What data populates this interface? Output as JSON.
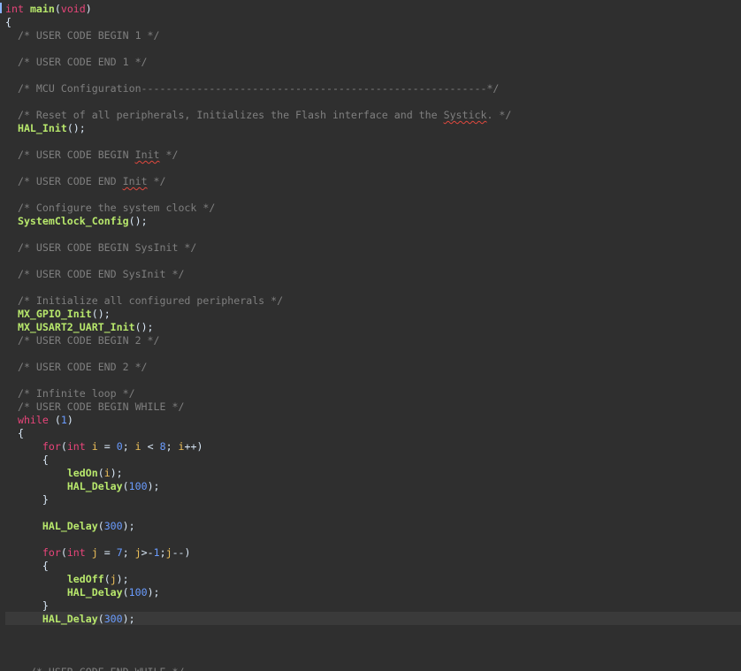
{
  "editor": {
    "colors": {
      "background": "#2f2f2f",
      "keyword": "#e8457a",
      "function": "#b8e86c",
      "comment": "#7f7f7f",
      "number": "#6a9cff",
      "variable": "#f0c25a",
      "text": "#d9e8f7"
    },
    "lines": [
      {
        "tokens": [
          {
            "t": "int",
            "c": "kw"
          },
          {
            "t": " ",
            "c": "pl"
          },
          {
            "t": "main",
            "c": "fn"
          },
          {
            "t": "(",
            "c": "pl"
          },
          {
            "t": "void",
            "c": "kw"
          },
          {
            "t": ")",
            "c": "pl"
          }
        ]
      },
      {
        "tokens": [
          {
            "t": "{",
            "c": "pl"
          }
        ]
      },
      {
        "tokens": [
          {
            "t": "  /* USER CODE BEGIN 1 */",
            "c": "cm"
          }
        ]
      },
      {
        "tokens": []
      },
      {
        "tokens": [
          {
            "t": "  /* USER CODE END 1 */",
            "c": "cm"
          }
        ]
      },
      {
        "tokens": []
      },
      {
        "tokens": [
          {
            "t": "  /* MCU Configuration--------------------------------------------------------*/",
            "c": "cm"
          }
        ]
      },
      {
        "tokens": []
      },
      {
        "tokens": [
          {
            "t": "  /* Reset of all peripherals, Initializes the Flash interface and the ",
            "c": "cm"
          },
          {
            "t": "Systick",
            "c": "cm",
            "sq": true
          },
          {
            "t": ". */",
            "c": "cm"
          }
        ]
      },
      {
        "tokens": [
          {
            "t": "  ",
            "c": "pl"
          },
          {
            "t": "HAL_Init",
            "c": "fn"
          },
          {
            "t": "();",
            "c": "pl"
          }
        ]
      },
      {
        "tokens": []
      },
      {
        "tokens": [
          {
            "t": "  /* USER CODE BEGIN ",
            "c": "cm"
          },
          {
            "t": "Init",
            "c": "cm",
            "sq": true
          },
          {
            "t": " */",
            "c": "cm"
          }
        ]
      },
      {
        "tokens": []
      },
      {
        "tokens": [
          {
            "t": "  /* USER CODE END ",
            "c": "cm"
          },
          {
            "t": "Init",
            "c": "cm",
            "sq": true
          },
          {
            "t": " */",
            "c": "cm"
          }
        ]
      },
      {
        "tokens": []
      },
      {
        "tokens": [
          {
            "t": "  /* Configure the system clock */",
            "c": "cm"
          }
        ]
      },
      {
        "tokens": [
          {
            "t": "  ",
            "c": "pl"
          },
          {
            "t": "SystemClock_Config",
            "c": "fn"
          },
          {
            "t": "();",
            "c": "pl"
          }
        ]
      },
      {
        "tokens": []
      },
      {
        "tokens": [
          {
            "t": "  /* USER CODE BEGIN SysInit */",
            "c": "cm"
          }
        ]
      },
      {
        "tokens": []
      },
      {
        "tokens": [
          {
            "t": "  /* USER CODE END SysInit */",
            "c": "cm"
          }
        ]
      },
      {
        "tokens": []
      },
      {
        "tokens": [
          {
            "t": "  /* Initialize all configured peripherals */",
            "c": "cm"
          }
        ]
      },
      {
        "tokens": [
          {
            "t": "  ",
            "c": "pl"
          },
          {
            "t": "MX_GPIO_Init",
            "c": "fn"
          },
          {
            "t": "();",
            "c": "pl"
          }
        ]
      },
      {
        "tokens": [
          {
            "t": "  ",
            "c": "pl"
          },
          {
            "t": "MX_USART2_UART_Init",
            "c": "fn"
          },
          {
            "t": "();",
            "c": "pl"
          }
        ]
      },
      {
        "tokens": [
          {
            "t": "  /* USER CODE BEGIN 2 */",
            "c": "cm"
          }
        ]
      },
      {
        "tokens": []
      },
      {
        "tokens": [
          {
            "t": "  /* USER CODE END 2 */",
            "c": "cm"
          }
        ]
      },
      {
        "tokens": []
      },
      {
        "tokens": [
          {
            "t": "  /* Infinite loop */",
            "c": "cm"
          }
        ]
      },
      {
        "tokens": [
          {
            "t": "  /* USER CODE BEGIN WHILE */",
            "c": "cm"
          }
        ]
      },
      {
        "tokens": [
          {
            "t": "  ",
            "c": "pl"
          },
          {
            "t": "while",
            "c": "kw"
          },
          {
            "t": " (",
            "c": "pl"
          },
          {
            "t": "1",
            "c": "num"
          },
          {
            "t": ")",
            "c": "pl"
          }
        ]
      },
      {
        "tokens": [
          {
            "t": "  {",
            "c": "pl"
          }
        ]
      },
      {
        "tokens": [
          {
            "t": "      ",
            "c": "pl"
          },
          {
            "t": "for",
            "c": "kw"
          },
          {
            "t": "(",
            "c": "pl"
          },
          {
            "t": "int",
            "c": "kw"
          },
          {
            "t": " ",
            "c": "pl"
          },
          {
            "t": "i",
            "c": "var"
          },
          {
            "t": " = ",
            "c": "pl"
          },
          {
            "t": "0",
            "c": "num"
          },
          {
            "t": "; ",
            "c": "pl"
          },
          {
            "t": "i",
            "c": "var"
          },
          {
            "t": " < ",
            "c": "pl"
          },
          {
            "t": "8",
            "c": "num"
          },
          {
            "t": "; ",
            "c": "pl"
          },
          {
            "t": "i",
            "c": "var"
          },
          {
            "t": "++)",
            "c": "pl"
          }
        ]
      },
      {
        "tokens": [
          {
            "t": "      {",
            "c": "pl"
          }
        ]
      },
      {
        "tokens": [
          {
            "t": "          ",
            "c": "pl"
          },
          {
            "t": "ledOn",
            "c": "fn"
          },
          {
            "t": "(",
            "c": "pl"
          },
          {
            "t": "i",
            "c": "var"
          },
          {
            "t": ");",
            "c": "pl"
          }
        ]
      },
      {
        "tokens": [
          {
            "t": "          ",
            "c": "pl"
          },
          {
            "t": "HAL_Delay",
            "c": "fn"
          },
          {
            "t": "(",
            "c": "pl"
          },
          {
            "t": "100",
            "c": "num"
          },
          {
            "t": ");",
            "c": "pl"
          }
        ]
      },
      {
        "tokens": [
          {
            "t": "      }",
            "c": "pl"
          }
        ]
      },
      {
        "tokens": []
      },
      {
        "tokens": [
          {
            "t": "      ",
            "c": "pl"
          },
          {
            "t": "HAL_Delay",
            "c": "fn"
          },
          {
            "t": "(",
            "c": "pl"
          },
          {
            "t": "300",
            "c": "num"
          },
          {
            "t": ");",
            "c": "pl"
          }
        ]
      },
      {
        "tokens": []
      },
      {
        "tokens": [
          {
            "t": "      ",
            "c": "pl"
          },
          {
            "t": "for",
            "c": "kw"
          },
          {
            "t": "(",
            "c": "pl"
          },
          {
            "t": "int",
            "c": "kw"
          },
          {
            "t": " ",
            "c": "pl"
          },
          {
            "t": "j",
            "c": "var"
          },
          {
            "t": " = ",
            "c": "pl"
          },
          {
            "t": "7",
            "c": "num"
          },
          {
            "t": "; ",
            "c": "pl"
          },
          {
            "t": "j",
            "c": "var"
          },
          {
            "t": ">-",
            "c": "pl"
          },
          {
            "t": "1",
            "c": "num"
          },
          {
            "t": ";",
            "c": "pl"
          },
          {
            "t": "j",
            "c": "var"
          },
          {
            "t": "--)",
            "c": "pl"
          }
        ]
      },
      {
        "tokens": [
          {
            "t": "      {",
            "c": "pl"
          }
        ]
      },
      {
        "tokens": [
          {
            "t": "          ",
            "c": "pl"
          },
          {
            "t": "ledOff",
            "c": "fn"
          },
          {
            "t": "(",
            "c": "pl"
          },
          {
            "t": "j",
            "c": "var"
          },
          {
            "t": ");",
            "c": "pl"
          }
        ]
      },
      {
        "tokens": [
          {
            "t": "          ",
            "c": "pl"
          },
          {
            "t": "HAL_Delay",
            "c": "fn"
          },
          {
            "t": "(",
            "c": "pl"
          },
          {
            "t": "100",
            "c": "num"
          },
          {
            "t": ");",
            "c": "pl"
          }
        ]
      },
      {
        "tokens": [
          {
            "t": "      }",
            "c": "pl"
          }
        ]
      },
      {
        "tokens": [
          {
            "t": "      ",
            "c": "pl"
          },
          {
            "t": "HAL_Delay",
            "c": "fn"
          },
          {
            "t": "(",
            "c": "pl"
          },
          {
            "t": "300",
            "c": "num"
          },
          {
            "t": ");",
            "c": "pl"
          }
        ]
      },
      {
        "tokens": []
      },
      {
        "tokens": []
      },
      {
        "tokens": []
      },
      {
        "tokens": [
          {
            "t": "    /* USER CODE END WHILE */",
            "c": "cm"
          }
        ]
      }
    ]
  }
}
